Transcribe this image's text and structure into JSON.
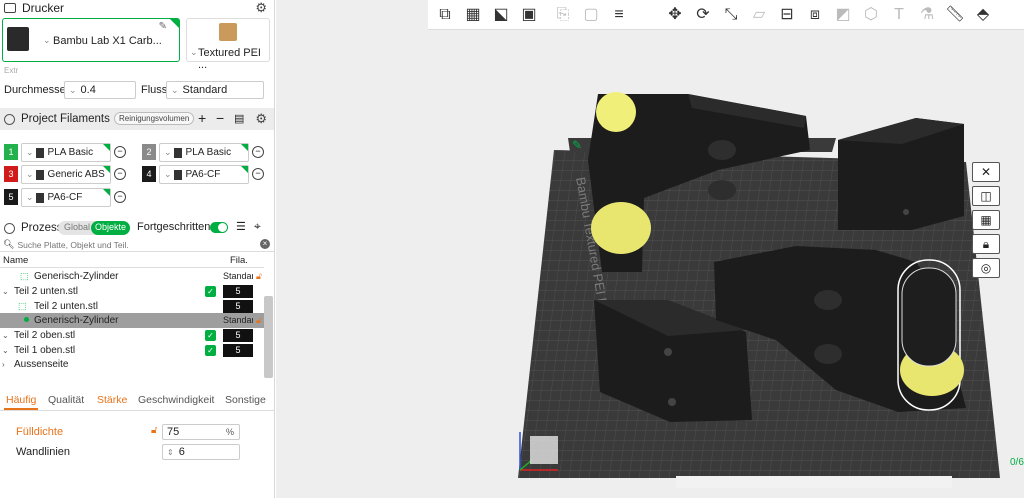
{
  "printer_section": {
    "title": "Drucker",
    "printer_name": "Bambu Lab X1 Carb...",
    "plate_name": "Textured PEI ...",
    "extruder_label": "Extr",
    "diameter_label": "Durchmesser",
    "diameter_value": "0.4",
    "flow_label": "Fluss",
    "flow_value": "Standard"
  },
  "filaments_section": {
    "title": "Project Filaments",
    "purge_button": "Reinigungsvolumen",
    "add_label": "+",
    "remove_label": "−",
    "items": [
      {
        "num": "1",
        "name": "PLA Basic",
        "color": "#22b14c"
      },
      {
        "num": "2",
        "name": "PLA Basic",
        "color": "#8a8a8a"
      },
      {
        "num": "3",
        "name": "Generic ABS",
        "color": "#d11b1b"
      },
      {
        "num": "4",
        "name": "PA6-CF",
        "color": "#1a1a1a"
      },
      {
        "num": "5",
        "name": "PA6-CF",
        "color": "#1a1a1a"
      }
    ]
  },
  "process_section": {
    "title": "Prozess",
    "toggle_global": "Global",
    "toggle_objects": "Objekte",
    "advanced_label": "Fortgeschritten",
    "search_placeholder": "Suche Platte, Objekt und Teil.",
    "col_name": "Name",
    "col_filament": "Fila.",
    "rows": [
      {
        "label": "Generisch-Zylinder",
        "value": "Standar",
        "kind": "modifier"
      },
      {
        "label": "Teil 2 unten.stl",
        "value": "5",
        "kind": "object"
      },
      {
        "label": "Teil 2 unten.stl",
        "value": "5",
        "kind": "part"
      },
      {
        "label": "Generisch-Zylinder",
        "value": "Standar",
        "kind": "selected"
      },
      {
        "label": "Teil 2 oben.stl",
        "value": "5",
        "kind": "object"
      },
      {
        "label": "Teil 1 oben.stl",
        "value": "5",
        "kind": "object"
      },
      {
        "label": "Aussenseite",
        "value": "",
        "kind": "group"
      }
    ]
  },
  "settings_tabs": {
    "tabs": [
      "Häufig",
      "Qualität",
      "Stärke",
      "Geschwindigkeit",
      "Sonstige"
    ],
    "infill_label": "Fülldichte",
    "infill_value": "75",
    "infill_unit": "%",
    "walls_label": "Wandlinien",
    "walls_value": "6"
  },
  "viewport": {
    "plate_text": "Bambu Textured PEI Plate",
    "corner_text": "0/6"
  },
  "colors": {
    "accent": "#00ae42",
    "warning": "#e8731b",
    "plate": "#3a3a3a",
    "model": "#1c1c1c",
    "modifier": "#f0ef7a"
  }
}
